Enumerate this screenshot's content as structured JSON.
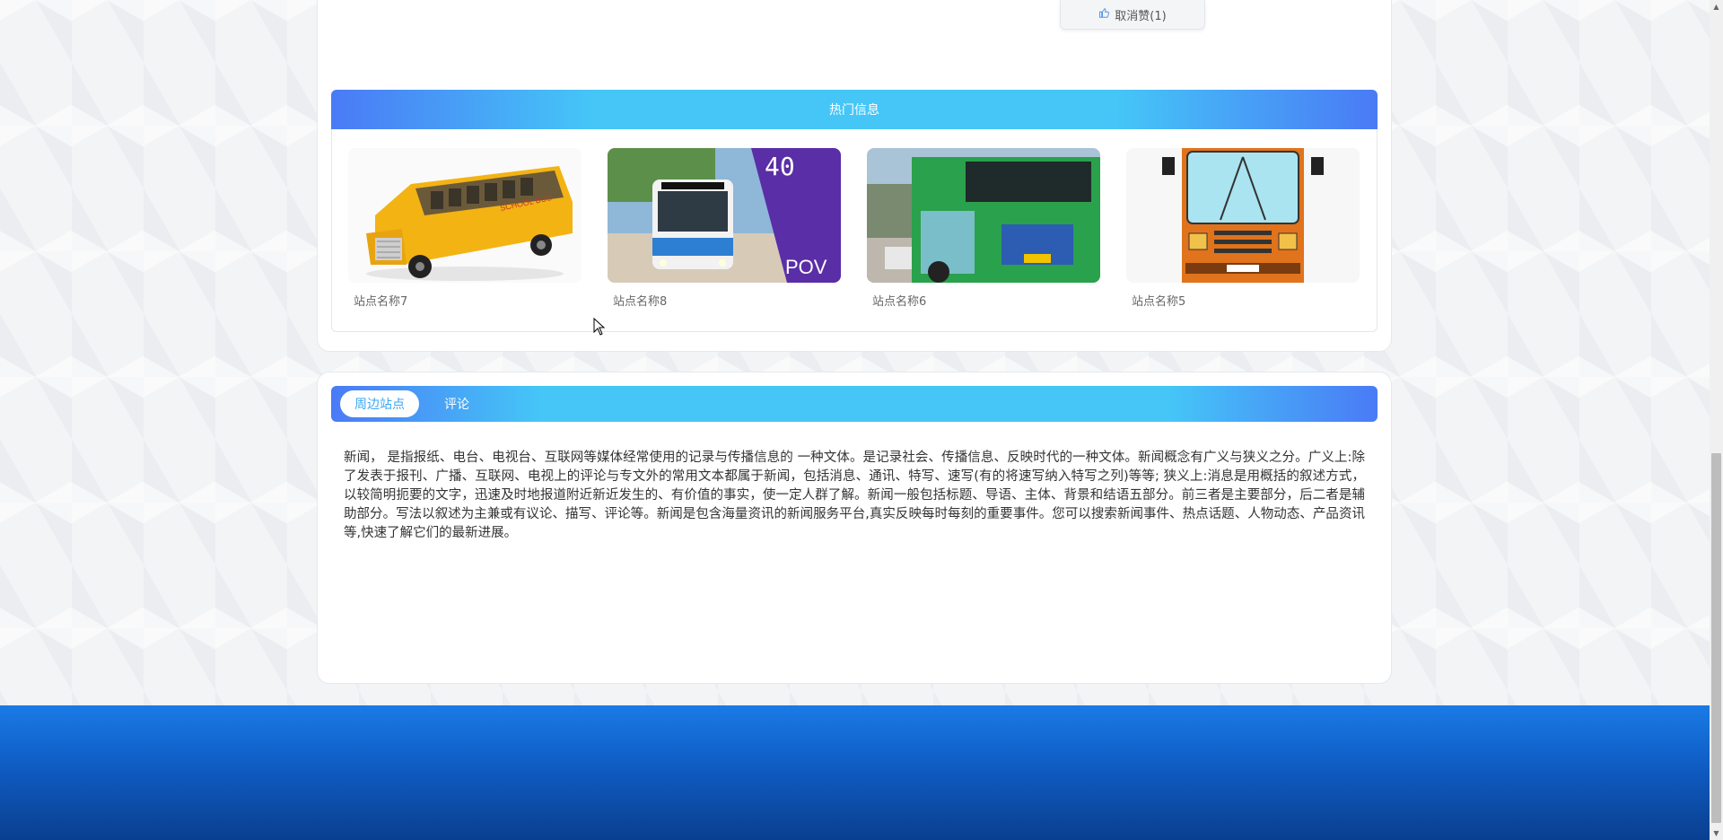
{
  "like_button": {
    "label": "取消赞(1)",
    "icon": "thumb-up-icon"
  },
  "hot_section": {
    "title": "热门信息",
    "items": [
      {
        "name": "站点名称7",
        "image": "yellow-school-bus"
      },
      {
        "name": "站点名称8",
        "image": "city-bus-front"
      },
      {
        "name": "站点名称6",
        "image": "green-bus-rear"
      },
      {
        "name": "站点名称5",
        "image": "orange-bus-illustration"
      }
    ]
  },
  "tabs": [
    {
      "label": "周边站点",
      "active": true
    },
    {
      "label": "评论",
      "active": false
    }
  ],
  "article": {
    "text": "新闻， 是指报纸、电台、电视台、互联网等媒体经常使用的记录与传播信息的 一种文体。是记录社会、传播信息、反映时代的一种文体。新闻概念有广义与狭义之分。广义上:除了发表于报刊、广播、互联网、电视上的评论与专文外的常用文本都属于新闻，包括消息、通讯、特写、速写(有的将速写纳入特写之列)等等; 狭义上:消息是用概括的叙述方式，以较简明扼要的文字，迅速及时地报道附近新近发生的、有价值的事实，使一定人群了解。新闻一般包括标题、导语、主体、背景和结语五部分。前三者是主要部分，后二者是辅助部分。写法以叙述为主兼或有议论、描写、评论等。新闻是包含海量资讯的新闻服务平台,真实反映每时每刻的重要事件。您可以搜索新闻事件、热点话题、人物动态、产品资讯等,快速了解它们的最新进展。"
  },
  "colors": {
    "header_gradient_start": "#4a7af6",
    "header_gradient_mid": "#45c6f7",
    "footer_top": "#1a7be6",
    "footer_bottom": "#0a3f8f",
    "active_tab_text": "#3aa7f2"
  }
}
